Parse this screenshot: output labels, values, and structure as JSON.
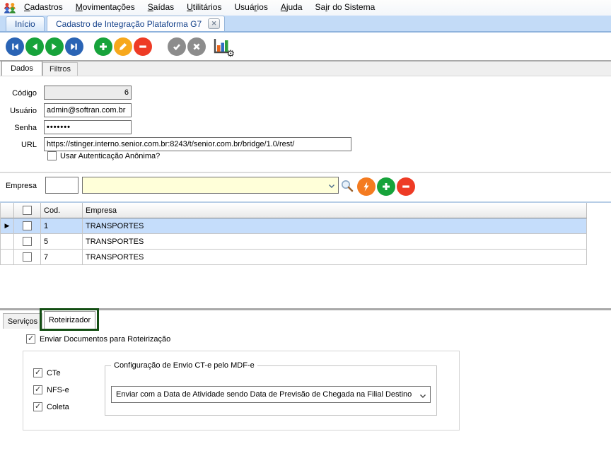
{
  "menubar": {
    "app_icon": "users-group-icon",
    "items": [
      {
        "label": "Cadastros",
        "underline": 0
      },
      {
        "label": "Movimentações",
        "underline": 0
      },
      {
        "label": "Saídas",
        "underline": 0
      },
      {
        "label": "Utilitários",
        "underline": 0
      },
      {
        "label": "Usuários",
        "underline": 4
      },
      {
        "label": "Ajuda",
        "underline": 0
      },
      {
        "label": "Sair do Sistema",
        "underline": 2
      }
    ]
  },
  "window_tabs": {
    "items": [
      {
        "label": "Início",
        "active": false
      },
      {
        "label": "Cadastro de Integração Plataforma G7",
        "active": true,
        "close_icon": "✕"
      }
    ]
  },
  "toolbar": {
    "buttons": [
      {
        "name": "first-record",
        "color": "#2a64b5"
      },
      {
        "name": "previous-record",
        "color": "#17a33b"
      },
      {
        "name": "next-record",
        "color": "#17a33b"
      },
      {
        "name": "last-record",
        "color": "#2a64b5"
      },
      {
        "name": "add-record",
        "color": "#17a33b"
      },
      {
        "name": "edit-record",
        "color": "#f7a81c"
      },
      {
        "name": "delete-record",
        "color": "#ee3b25"
      },
      {
        "name": "confirm",
        "color": "#8c8c8c"
      },
      {
        "name": "cancel",
        "color": "#8c8c8c"
      },
      {
        "name": "chart-settings",
        "color": ""
      }
    ]
  },
  "subtabs": {
    "items": [
      {
        "label": "Dados",
        "active": true
      },
      {
        "label": "Filtros",
        "active": false
      }
    ]
  },
  "form": {
    "codigo": {
      "label": "Código",
      "value": "6"
    },
    "usuario": {
      "label": "Usuário",
      "value": "admin@softran.com.br"
    },
    "senha": {
      "label": "Senha",
      "value": "•••••••"
    },
    "url": {
      "label": "URL",
      "value": "https://stinger.interno.senior.com.br:8243/t/senior.com.br/bridge/1.0/rest/"
    },
    "anonimo": {
      "label": "Usar Autenticação Anônima?",
      "checked": false
    }
  },
  "empresa_picker": {
    "label": "Empresa",
    "code_value": "",
    "name_value": "",
    "icons": [
      "search-icon",
      "lightning-sync-icon",
      "add-icon",
      "remove-icon"
    ]
  },
  "table": {
    "headers": {
      "cod": "Cod.",
      "empresa": "Empresa"
    },
    "select_all_checked": false,
    "rows": [
      {
        "cod": "1",
        "empresa": "TRANSPORTES",
        "checked": false,
        "selected": true
      },
      {
        "cod": "5",
        "empresa": "TRANSPORTES",
        "checked": false,
        "selected": false
      },
      {
        "cod": "7",
        "empresa": "TRANSPORTES",
        "checked": false,
        "selected": false
      }
    ]
  },
  "bottom_tabs": {
    "items": [
      {
        "label": "Serviços",
        "active": false
      },
      {
        "label": "Roteirizador",
        "active": true,
        "highlighted": true
      }
    ],
    "highlight_color": "#134e13"
  },
  "roteirizador": {
    "enviar_documentos": {
      "label": "Enviar Documentos para Roteirização",
      "checked": true
    },
    "doc_types": [
      {
        "label": "CTe",
        "checked": true
      },
      {
        "label": "NFS-e",
        "checked": true
      },
      {
        "label": "Coleta",
        "checked": true
      }
    ],
    "groupbox_title": "Configuração de Envio CT-e pelo MDF-e",
    "envio_select": {
      "value": "Enviar com a Data de Atividade sendo Data de Previsão de Chegada na Filial Destino"
    }
  }
}
